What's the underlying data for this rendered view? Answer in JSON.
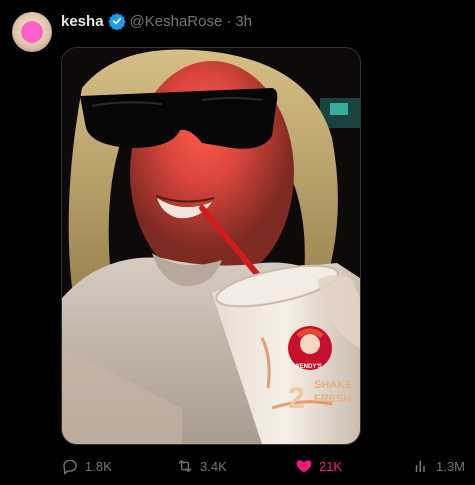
{
  "tweet": {
    "author_name": "kesha",
    "handle": "@KeshaRose",
    "separator": "·",
    "time": "3h",
    "verified": true
  },
  "media": {
    "cup_text": [
      "WENDY'S",
      "2",
      "SHAKE",
      "FRESH"
    ]
  },
  "actions": {
    "replies": "1.8K",
    "reposts": "3.4K",
    "likes": "21K",
    "views": "1.3M",
    "liked": true
  },
  "colors": {
    "background": "#000000",
    "muted": "#71767b",
    "verified": "#1d9bf0",
    "like": "#f91880",
    "avatar_blob": "#ff5fc6"
  },
  "icons": [
    "verified-badge-icon",
    "reply-icon",
    "repost-icon",
    "heart-icon",
    "views-icon"
  ]
}
